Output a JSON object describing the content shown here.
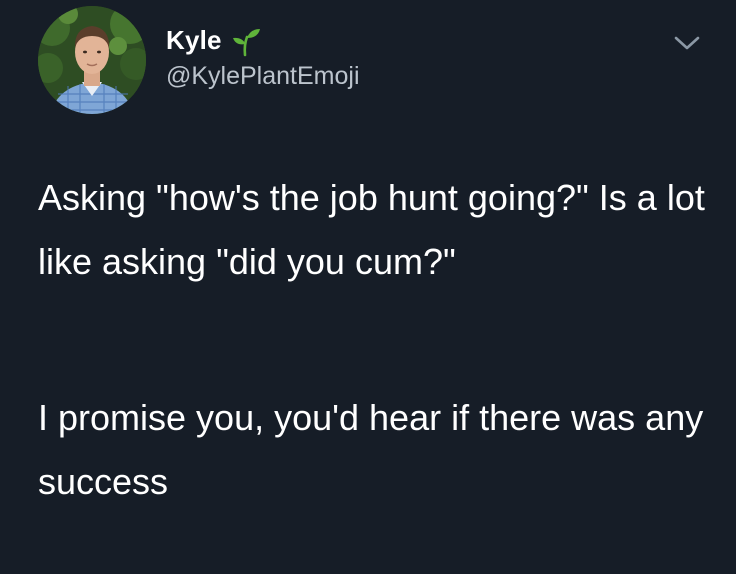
{
  "author": {
    "display_name": "Kyle",
    "handle": "@KylePlantEmoji",
    "name_emoji": "seedling-icon"
  },
  "tweet": {
    "paragraphs": [
      "Asking \"how's the job hunt going?\" Is a lot like asking \"did you cum?\"",
      "I promise you, you'd hear if there was any success"
    ]
  },
  "colors": {
    "background": "#161d27",
    "text": "#ffffff",
    "secondary_text": "#bcc4cd",
    "emoji_green": "#5fb43a"
  }
}
